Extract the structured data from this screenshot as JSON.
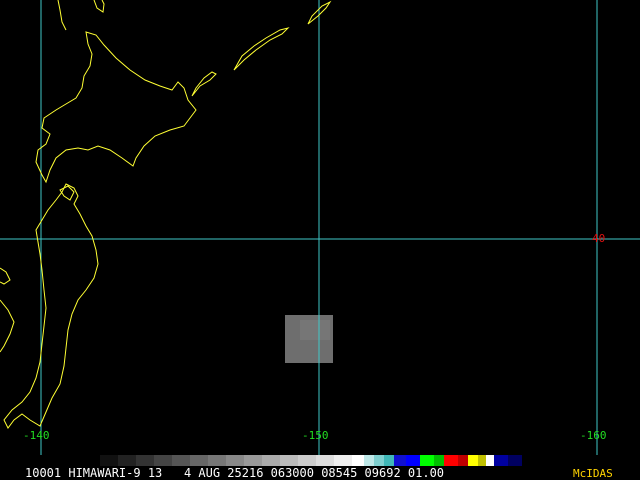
{
  "colors": {
    "background": "#000000",
    "coastline": "#ffff33",
    "gridline": "#40c8c8",
    "longitude_label": "#22dd22",
    "latitude_label": "#dd1111",
    "cloud_patch": "#6e6e6e",
    "status_text": "#ffffff",
    "brand": "#ffd400"
  },
  "grid": {
    "longitudes": [
      {
        "label": "-140"
      },
      {
        "label": "-150"
      },
      {
        "label": "-160"
      }
    ],
    "latitudes": [
      {
        "label": "40"
      }
    ]
  },
  "status": {
    "text": "10001 HIMAWARI-9 13   4 AUG 25216 063000 08545 09692 01.00",
    "brand": "McIDAS"
  },
  "colorbar": {
    "stops": [
      "#000000",
      "#111111",
      "#222222",
      "#333333",
      "#444444",
      "#555555",
      "#666666",
      "#777777",
      "#888888",
      "#999999",
      "#aaaaaa",
      "#bbbbbb",
      "#cccccc",
      "#dddddd",
      "#eeeeee",
      "#ffffff",
      "#bfe8e8",
      "#7fd0d0",
      "#40b8b8",
      "#1010d0",
      "#0000ff",
      "#00ff00",
      "#00c000",
      "#ff0000",
      "#c00000",
      "#ffff00",
      "#c0c000",
      "#ffffff",
      "#0000a0",
      "#000060"
    ]
  },
  "icons": {
    "map": "coastline-map-icon"
  }
}
